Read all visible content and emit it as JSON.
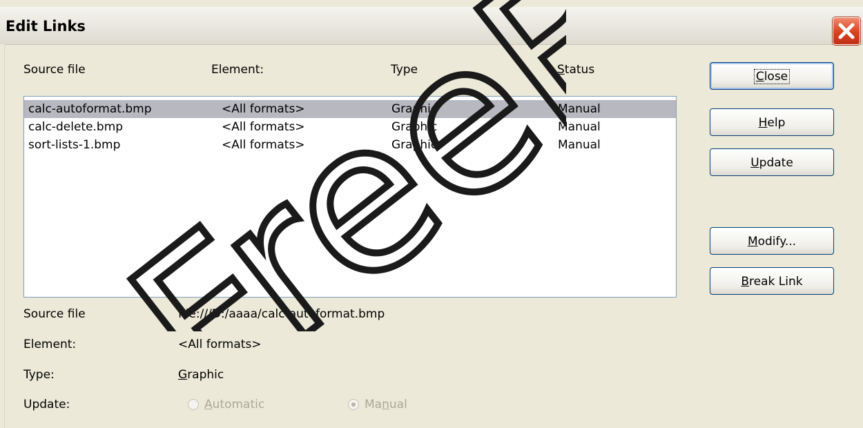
{
  "window": {
    "title": "Edit Links"
  },
  "columns": {
    "source": "Source file",
    "element": "Element:",
    "type": "Type",
    "status_prefix": "S",
    "status_rest": "tatus"
  },
  "links": [
    {
      "source": "calc-autoformat.bmp",
      "element": "<All formats>",
      "type": "Graphic",
      "status": "Manual",
      "selected": true
    },
    {
      "source": "calc-delete.bmp",
      "element": "<All formats>",
      "type": "Graphic",
      "status": "Manual",
      "selected": false
    },
    {
      "source": "sort-lists-1.bmp",
      "element": "<All formats>",
      "type": "Graphic",
      "status": "Manual",
      "selected": false
    }
  ],
  "buttons": {
    "close": {
      "mnemonic": "C",
      "rest": "lose"
    },
    "help": {
      "mnemonic": "H",
      "rest": "elp"
    },
    "update": {
      "mnemonic": "U",
      "rest": "pdate"
    },
    "modify": {
      "mnemonic": "M",
      "rest": "odify..."
    },
    "break_link": {
      "mnemonic": "B",
      "rest": "reak Link"
    }
  },
  "details": {
    "source_label": "Source file",
    "source_value": "file:///D:/aaaa/calc-autoformat.bmp",
    "element_label": "Element:",
    "element_value": "<All formats>",
    "type_label": "Type:",
    "type_value_mnemonic": "G",
    "type_value_rest": "raphic",
    "update_label": "Update:",
    "automatic_mnemonic": "A",
    "automatic_rest": "utomatic",
    "manual_prefix": "Ma",
    "manual_mnemonic": "n",
    "manual_rest": "ual",
    "selected_update_mode": "Manual"
  },
  "watermark": {
    "text": "FreeB"
  },
  "colors": {
    "dialog_bg": "#ece9d8",
    "selection_bg": "#b8b8c0",
    "close_red": "#d8431e",
    "disabled_text": "#aca899"
  },
  "icons": {
    "close": "close-x-icon",
    "radio_automatic": "radio-unchecked-icon",
    "radio_manual": "radio-checked-icon"
  }
}
